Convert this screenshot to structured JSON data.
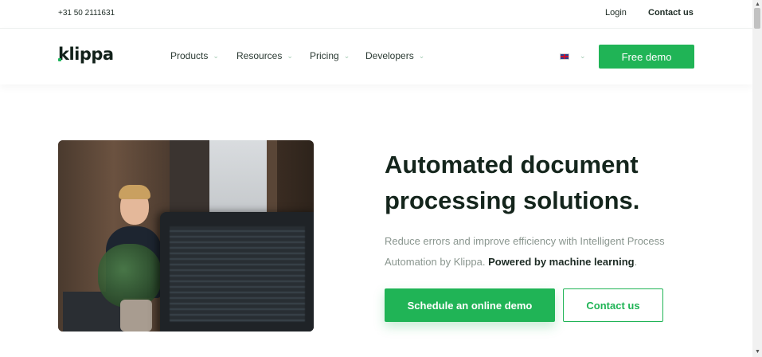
{
  "topbar": {
    "phone": "+31 50 2111631",
    "login": "Login",
    "contact": "Contact us"
  },
  "nav": {
    "logo": "klippa",
    "items": [
      {
        "label": "Products"
      },
      {
        "label": "Resources"
      },
      {
        "label": "Pricing"
      },
      {
        "label": "Developers"
      }
    ],
    "language_icon": "uk-flag-icon",
    "cta": "Free demo"
  },
  "hero": {
    "headline_line1": "Automated document",
    "headline_line2": "processing solutions.",
    "sub_text": "Reduce errors and improve efficiency with Intelligent Process Automation by Klippa. ",
    "sub_bold": "Powered by machine learning",
    "sub_end": ".",
    "primary_button": "Schedule an online demo",
    "secondary_button": "Contact us"
  },
  "colors": {
    "accent": "#20b456",
    "heading": "#14251c",
    "muted": "#8a968f"
  }
}
